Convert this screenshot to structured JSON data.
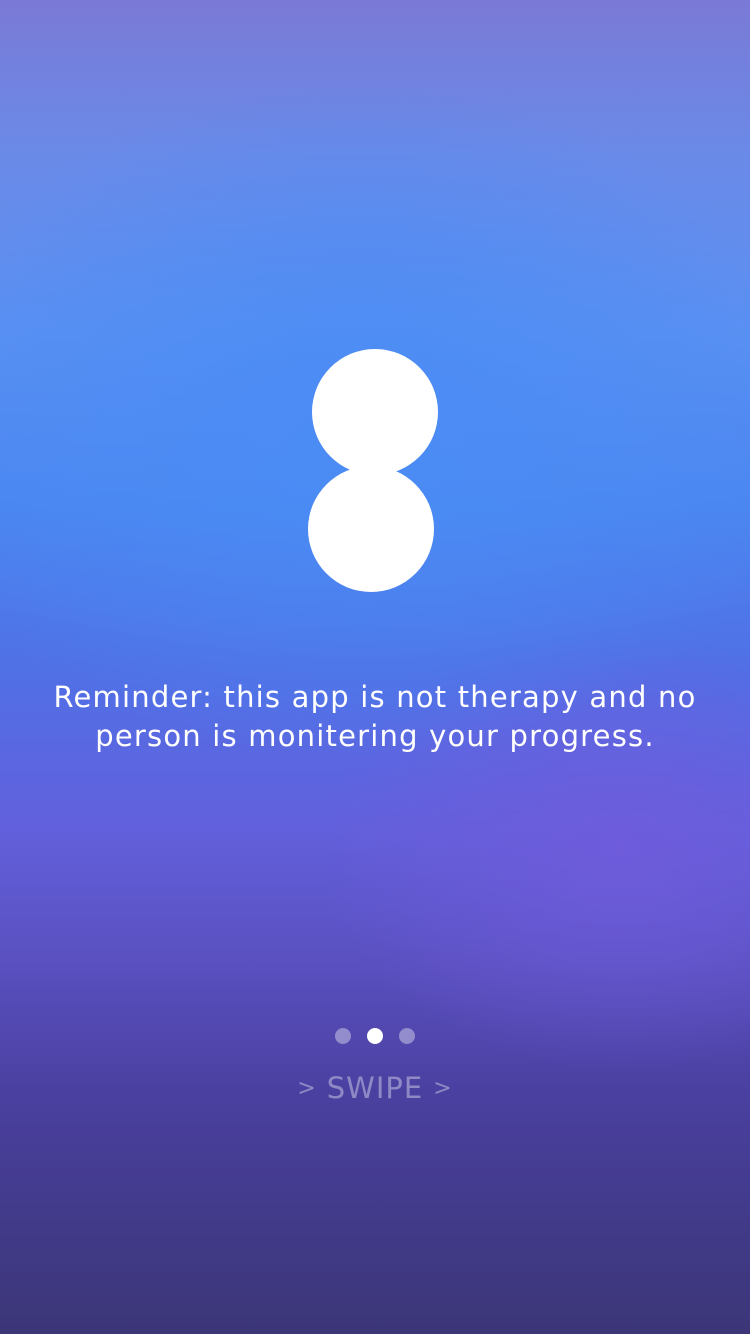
{
  "logo": {
    "icon": "two-circles-logo-icon",
    "color": "#ffffff"
  },
  "message": {
    "line1": "Reminder: this app is not therapy and no",
    "line2": "person is monitering your progress."
  },
  "pager": {
    "total": 3,
    "active_index": 1
  },
  "swipe": {
    "label": "SWIPE",
    "left_chevron": ">",
    "right_chevron": ">"
  },
  "colors": {
    "top": "#7a7ad6",
    "middle": "#4b86f0",
    "bottom": "#3c3678",
    "text": "#ffffff"
  }
}
